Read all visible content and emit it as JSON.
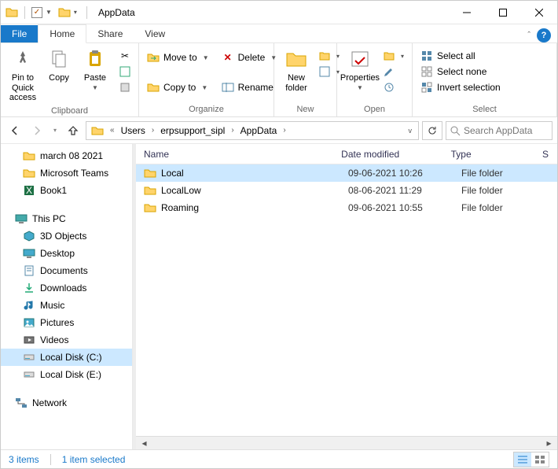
{
  "window": {
    "title": "AppData"
  },
  "tabs": {
    "file": "File",
    "home": "Home",
    "share": "Share",
    "view": "View"
  },
  "ribbon": {
    "clipboard": {
      "label": "Clipboard",
      "pin": "Pin to Quick\naccess",
      "copy": "Copy",
      "paste": "Paste"
    },
    "organize": {
      "label": "Organize",
      "moveto": "Move to",
      "copyto": "Copy to",
      "delete": "Delete",
      "rename": "Rename"
    },
    "new": {
      "label": "New",
      "newfolder": "New\nfolder"
    },
    "open": {
      "label": "Open",
      "properties": "Properties"
    },
    "select": {
      "label": "Select",
      "selectall": "Select all",
      "selectnone": "Select none",
      "invert": "Invert selection"
    }
  },
  "breadcrumb": {
    "parts": [
      "Users",
      "erpsupport_sipl",
      "AppData"
    ],
    "search_placeholder": "Search AppData"
  },
  "navpane": {
    "quick": [
      {
        "label": "march 08 2021",
        "icon": "folder"
      },
      {
        "label": "Microsoft Teams",
        "icon": "folder"
      },
      {
        "label": "Book1",
        "icon": "excel"
      }
    ],
    "thispc": {
      "header": "This PC",
      "items": [
        {
          "label": "3D Objects",
          "icon": "3d"
        },
        {
          "label": "Desktop",
          "icon": "desktop"
        },
        {
          "label": "Documents",
          "icon": "documents"
        },
        {
          "label": "Downloads",
          "icon": "downloads"
        },
        {
          "label": "Music",
          "icon": "music"
        },
        {
          "label": "Pictures",
          "icon": "pictures"
        },
        {
          "label": "Videos",
          "icon": "videos"
        },
        {
          "label": "Local Disk (C:)",
          "icon": "disk",
          "selected": true
        },
        {
          "label": "Local Disk (E:)",
          "icon": "disk"
        }
      ]
    },
    "network": {
      "label": "Network"
    }
  },
  "columns": {
    "name": "Name",
    "date": "Date modified",
    "type": "Type",
    "size": "S"
  },
  "rows": [
    {
      "name": "Local",
      "date": "09-06-2021 10:26",
      "type": "File folder",
      "selected": true
    },
    {
      "name": "LocalLow",
      "date": "08-06-2021 11:29",
      "type": "File folder"
    },
    {
      "name": "Roaming",
      "date": "09-06-2021 10:55",
      "type": "File folder"
    }
  ],
  "status": {
    "count": "3 items",
    "selected": "1 item selected"
  }
}
